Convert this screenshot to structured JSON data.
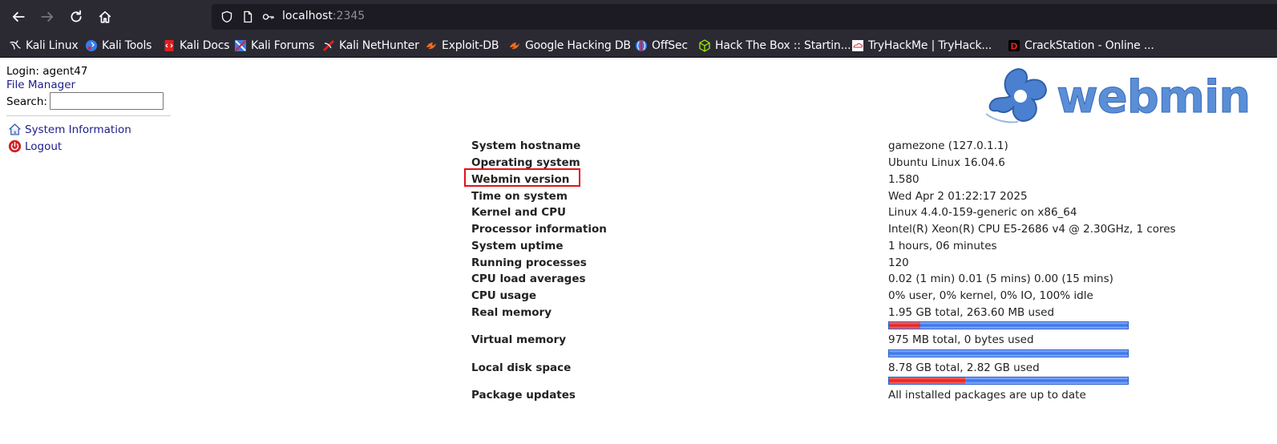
{
  "browser": {
    "url_host": "localhost",
    "url_port": ":2345"
  },
  "bookmarks": [
    {
      "label": "Kali Linux",
      "icon": "kali-dragon-icon"
    },
    {
      "label": "Kali Tools",
      "icon": "kali-tools-icon"
    },
    {
      "label": "Kali Docs",
      "icon": "kali-docs-icon"
    },
    {
      "label": "Kali Forums",
      "icon": "kali-forums-icon"
    },
    {
      "label": "Kali NetHunter",
      "icon": "kali-nethunter-icon"
    },
    {
      "label": "Exploit-DB",
      "icon": "exploit-db-icon"
    },
    {
      "label": "Google Hacking DB",
      "icon": "google-hacking-db-icon"
    },
    {
      "label": "OffSec",
      "icon": "offsec-icon"
    },
    {
      "label": "Hack The Box :: Startin...",
      "icon": "hackthebox-icon"
    },
    {
      "label": "TryHackMe | TryHack...",
      "icon": "tryhackme-icon"
    },
    {
      "label": "CrackStation - Online ...",
      "icon": "crackstation-icon"
    }
  ],
  "sidebar": {
    "login": "Login: agent47",
    "file_manager": "File Manager",
    "search_label": "Search:",
    "search_value": "",
    "links": [
      {
        "label": "System Information",
        "icon": "house-icon"
      },
      {
        "label": "Logout",
        "icon": "power-icon"
      }
    ]
  },
  "logo": {
    "text": "webmin"
  },
  "system_info": [
    {
      "label": "System hostname",
      "value": "gamezone (127.0.1.1)"
    },
    {
      "label": "Operating system",
      "value": "Ubuntu Linux 16.04.6"
    },
    {
      "label": "Webmin version",
      "value": "1.580"
    },
    {
      "label": "Time on system",
      "value": "Wed Apr 2 01:22:17 2025"
    },
    {
      "label": "Kernel and CPU",
      "value": "Linux 4.4.0-159-generic on x86_64"
    },
    {
      "label": "Processor information",
      "value": "Intel(R) Xeon(R) CPU E5-2686 v4 @ 2.30GHz, 1 cores"
    },
    {
      "label": "System uptime",
      "value": "1 hours, 06 minutes"
    },
    {
      "label": "Running processes",
      "value": "120"
    },
    {
      "label": "CPU load averages",
      "value": "0.02 (1 min) 0.01 (5 mins) 0.00 (15 mins)"
    },
    {
      "label": "CPU usage",
      "value": "0% user, 0% kernel, 0% IO, 100% idle"
    },
    {
      "label": "Real memory",
      "value": "1.95 GB total, 263.60 MB used",
      "usage_fraction": 0.13
    },
    {
      "label": "Virtual memory",
      "value": "975 MB total, 0 bytes used",
      "usage_fraction": 0.0
    },
    {
      "label": "Local disk space",
      "value": "8.78 GB total, 2.82 GB used",
      "usage_fraction": 0.32
    },
    {
      "label": "Package updates",
      "value": "All installed packages are up to date"
    }
  ],
  "colors": {
    "highlight": "#e0121b",
    "link": "#1c1c8c",
    "bar_used": "#e02020",
    "bar_free": "#3470e8"
  }
}
